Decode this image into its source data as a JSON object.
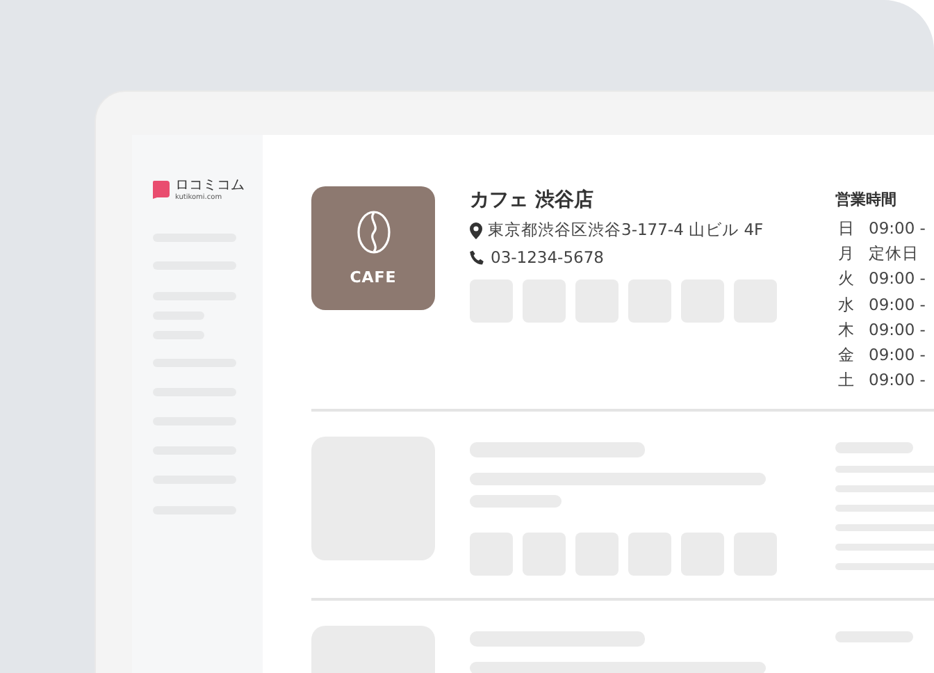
{
  "logo": {
    "name": "ロコミコム",
    "domain": "kutikomi.com"
  },
  "shop": {
    "thumbnail_label": "CAFE",
    "name": "カフェ 渋谷店",
    "address": "東京都渋谷区渋谷3-177-4 山ビル 4F",
    "phone": "03-1234-5678"
  },
  "hours": {
    "title": "営業時間",
    "rows": [
      {
        "day": "日",
        "time": "09:00 -"
      },
      {
        "day": "月",
        "time": "定休日"
      },
      {
        "day": "火",
        "time": "09:00 -"
      },
      {
        "day": "水",
        "time": "09:00 -"
      },
      {
        "day": "木",
        "time": "09:00 -"
      },
      {
        "day": "金",
        "time": "09:00 -"
      },
      {
        "day": "土",
        "time": "09:00 -"
      }
    ]
  }
}
